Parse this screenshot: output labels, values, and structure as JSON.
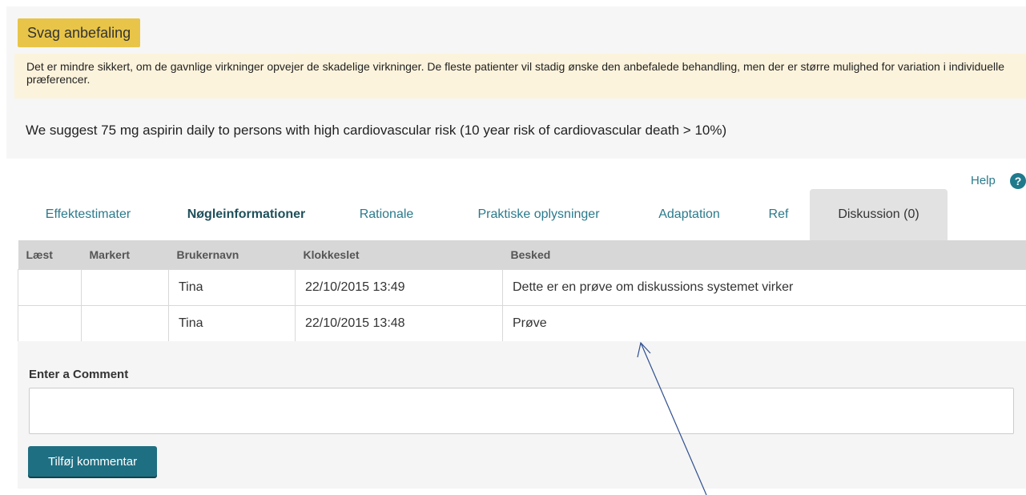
{
  "recommendation": {
    "strength": "Svag anbefaling",
    "strength_description": "Det er mindre sikkert, om de gavnlige virkninger opvejer de skadelige virkninger. De fleste patienter vil stadig ønske den anbefalede behandling, men der er større mulighed for variation i individuelle præferencer.",
    "text": "We suggest 75 mg aspirin daily to persons with high cardiovascular risk (10 year risk of cardiovascular death > 10%)"
  },
  "help": {
    "label": "Help",
    "icon": "question-circle-icon",
    "glyph": "?"
  },
  "tabs": [
    {
      "label": "Effektestimater"
    },
    {
      "label": "Nøgleinformationer"
    },
    {
      "label": "Rationale"
    },
    {
      "label": "Praktiske oplysninger"
    },
    {
      "label": "Adaptation"
    },
    {
      "label": "Ref"
    },
    {
      "label": "Diskussion (0)"
    }
  ],
  "discussion_table": {
    "columns": [
      "Læst",
      "Markert",
      "Brukernavn",
      "Klokkeslet",
      "Besked"
    ],
    "rows": [
      {
        "read": "",
        "marked": "",
        "username": "Tina",
        "time": "22/10/2015 13:49",
        "message": "Dette er en prøve om diskussions systemet virker"
      },
      {
        "read": "",
        "marked": "",
        "username": "Tina",
        "time": "22/10/2015 13:48",
        "message": "Prøve"
      }
    ]
  },
  "comment_form": {
    "label": "Enter a Comment",
    "input_value": "",
    "button_label": "Tilføj kommentar"
  },
  "colors": {
    "badge": "#e8c548",
    "badge_description_bg": "#fcf3dc",
    "accent": "#1f6f82",
    "tab_text": "#2b7a8c",
    "annotation_arrow": "#2f4f8f"
  }
}
